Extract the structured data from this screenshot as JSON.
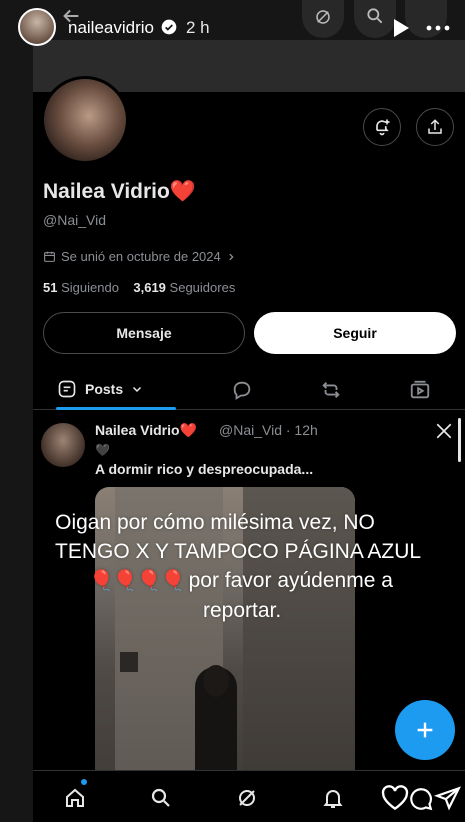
{
  "story": {
    "username": "naileavidrio",
    "time": "2 h"
  },
  "profile": {
    "display_name": "Nailea Vidrio❤️",
    "handle": "@Nai_Vid",
    "joined": "Se unió en octubre de 2024",
    "following_count": "51",
    "following_label": "Siguiendo",
    "followers_count": "3,619",
    "followers_label": "Seguidores",
    "message_button": "Mensaje",
    "follow_button": "Seguir"
  },
  "tabs": {
    "posts_label": "Posts"
  },
  "tweet": {
    "name": "Nailea Vidrio❤️",
    "meta": "@Nai_Vid · 12h",
    "emoji": "🖤",
    "text": "A dormir rico y despreocupada..."
  },
  "overlay": {
    "line1": "Oigan por cómo milésima vez, NO",
    "line2": "TENGO X Y TAMPOCO PÁGINA AZUL",
    "balloons": "🎈🎈🎈🎈",
    "line3": "por favor ayúdenme a",
    "line4": "reportar."
  },
  "colors": {
    "accent": "#1d9bf0",
    "background": "#000000",
    "muted_text": "#8b8f94"
  },
  "icons": [
    "verified-icon",
    "back-icon",
    "play-icon",
    "more-icon",
    "notification-add-icon",
    "share-icon",
    "calendar-icon",
    "posts-icon",
    "chevron-down-icon",
    "reply-icon",
    "repost-icon",
    "video-icon",
    "x-logo-icon",
    "plus-icon",
    "home-icon",
    "search-icon",
    "grok-icon",
    "bell-icon",
    "heart-icon",
    "comment-icon",
    "send-icon"
  ]
}
